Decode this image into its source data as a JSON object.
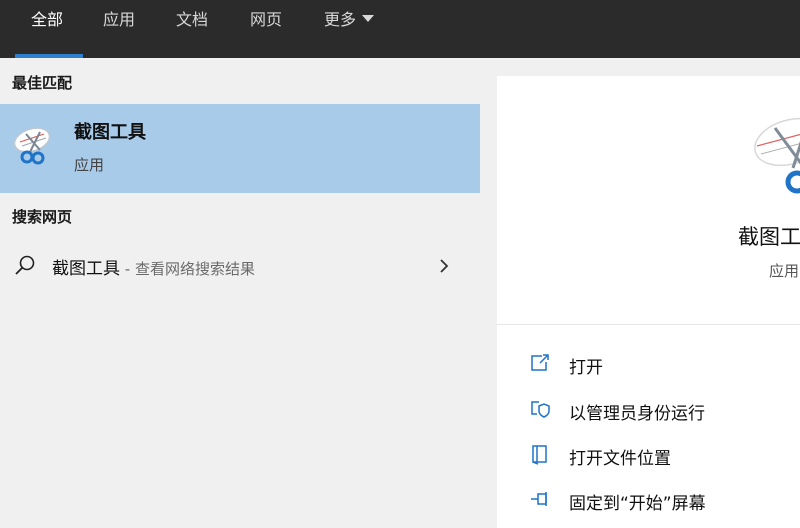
{
  "tabs": [
    {
      "label": "全部"
    },
    {
      "label": "应用"
    },
    {
      "label": "文档"
    },
    {
      "label": "网页"
    },
    {
      "label": "更多"
    }
  ],
  "best_match": {
    "heading": "最佳匹配",
    "app_name": "截图工具",
    "app_type": "应用"
  },
  "web_search": {
    "heading": "搜索网页",
    "query": "截图工具",
    "suffix": " - 查看网络搜索结果"
  },
  "detail": {
    "title": "截图工",
    "subtitle": "应用",
    "actions": [
      {
        "label": "打开",
        "icon": "open-icon"
      },
      {
        "label": "以管理员身份运行",
        "icon": "shield-icon"
      },
      {
        "label": "打开文件位置",
        "icon": "file-location-icon"
      },
      {
        "label": "固定到“开始”屏幕",
        "icon": "pin-icon"
      }
    ]
  },
  "colors": {
    "accent": "#2f7fd0",
    "selection": "#a8cbea",
    "topbar": "#2b2b2b"
  }
}
